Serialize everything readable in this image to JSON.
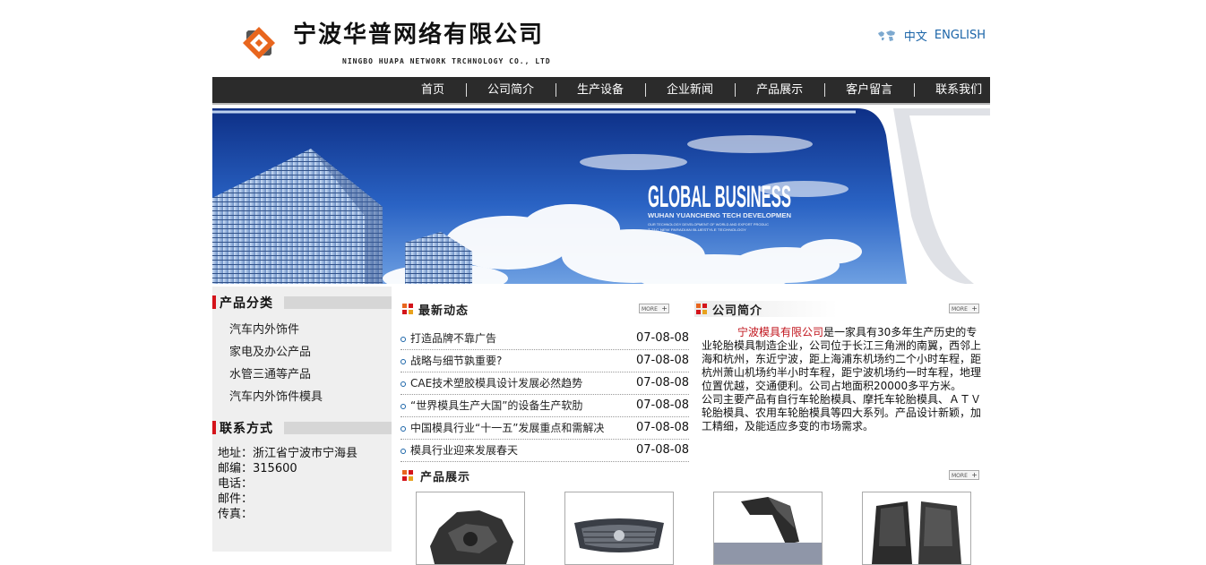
{
  "header": {
    "company_cn": "宁波华普网络有限公司",
    "company_en": "NINGBO HUAPA NETWORK TRCHNOLOGY CO., LTD",
    "lang_cn": "中文",
    "lang_en": "ENGLISH"
  },
  "nav": [
    "首页",
    "公司简介",
    "生产设备",
    "企业新闻",
    "产品展示",
    "客户留言",
    "联系我们"
  ],
  "banner": {
    "headline": "GLOBAL BUSINESS",
    "sub": "WUHAN YUANCHENG TECH DEVELOPMEN",
    "small1": "OUR TECHNOLOGY DEVELOPMENT OF WORLD AND EXPORT PRODUC",
    "small2": "T 21C NEW PARADIAN BLUESTYLE TECHNOLOGY"
  },
  "left": {
    "categories_title": "产品分类",
    "categories": [
      "汽车内外饰件",
      "家电及办公产品",
      "水管三通等产品",
      "汽车内外饰件模具"
    ],
    "contact_title": "联系方式",
    "contact": [
      "地址：浙江省宁波市宁海县",
      "邮编：315600",
      "电话：",
      "邮件：",
      "传真："
    ]
  },
  "news": {
    "title": "最新动态",
    "more": "MORE",
    "items": [
      {
        "title": "打造品牌不靠广告",
        "date": "07-08-08"
      },
      {
        "title": "战略与细节孰重要?",
        "date": "07-08-08"
      },
      {
        "title": "CAE技术塑胶模具设计发展必然趋势",
        "date": "07-08-08"
      },
      {
        "title": "“世界模具生产大国”的设备生产软肋",
        "date": "07-08-08"
      },
      {
        "title": "中国模具行业“十一五”发展重点和需解决",
        "date": "07-08-08"
      },
      {
        "title": "模具行业迎来发展春天",
        "date": "07-08-08"
      }
    ]
  },
  "intro": {
    "title": "公司简介",
    "more": "MORE",
    "highlight": "宁波模具有限公司",
    "text": "是一家具有30多年生产历史的专业轮胎模具制造企业，公司位于长江三角洲的南翼，西邻上海和杭州，东近宁波，距上海浦东机场约二个小时车程，距杭州萧山机场约半小时车程，距宁波机场约一时车程，地理位置优越，交通便利。公司占地面积20000多平方米。　　公司主要产品有自行车轮胎模具、摩托车轮胎模具、ＡＴＶ轮胎模具、农用车轮胎模具等四大系列。产品设计新颖，加工精细，及能适应多变的市场需求。"
  },
  "products": {
    "title": "产品展示",
    "more": "MORE"
  },
  "colors": {
    "nav_bg": "#2b2b2b",
    "accent_red": "#d4141b",
    "link_blue": "#1a64a8",
    "logo_orange": "#e8661e"
  }
}
